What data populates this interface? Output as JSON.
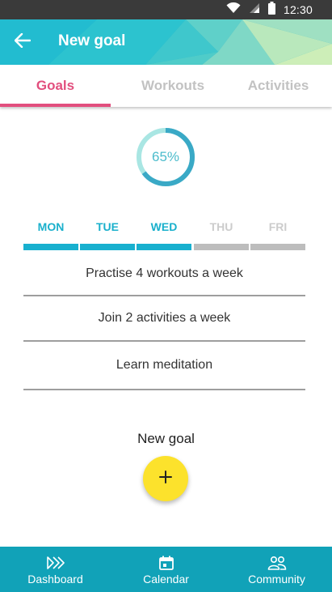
{
  "status_bar": {
    "time": "12:30",
    "icons": [
      "wifi-icon",
      "signal-icon",
      "battery-icon"
    ]
  },
  "app_bar": {
    "title": "New goal",
    "back_icon": "back-arrow-icon"
  },
  "tabs": [
    {
      "label": "Goals",
      "active": true
    },
    {
      "label": "Workouts",
      "active": false
    },
    {
      "label": "Activities",
      "active": false
    }
  ],
  "progress": {
    "percent": 65,
    "label": "65%"
  },
  "days": [
    {
      "label": "MON",
      "done": true
    },
    {
      "label": "TUE",
      "done": true
    },
    {
      "label": "WED",
      "done": true
    },
    {
      "label": "THU",
      "done": false
    },
    {
      "label": "FRI",
      "done": false
    }
  ],
  "goals": [
    {
      "label": "Practise 4 workouts a week"
    },
    {
      "label": "Join 2 activities a week"
    },
    {
      "label": "Learn meditation"
    }
  ],
  "new_goal": {
    "label": "New goal",
    "fab_icon": "plus-icon"
  },
  "bottom_nav": [
    {
      "label": "Dashboard",
      "icon": "dashboard-icon"
    },
    {
      "label": "Calendar",
      "icon": "calendar-icon"
    },
    {
      "label": "Community",
      "icon": "community-icon"
    }
  ],
  "colors": {
    "accent": "#e24f7e",
    "primary": "#1fb3c9",
    "nav": "#11a2b8",
    "fab": "#fce22c",
    "day_done": "#18b0cf",
    "day_pending": "#bdbdbd"
  }
}
